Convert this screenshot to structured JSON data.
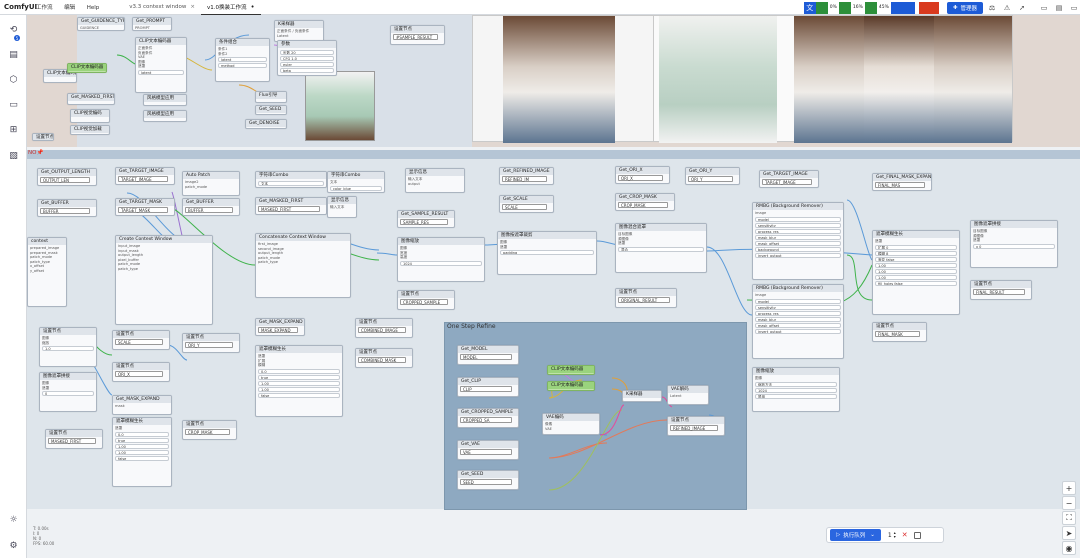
{
  "app": {
    "logo": "ComfyUI"
  },
  "menu": [
    "工作流",
    "编辑",
    "Help"
  ],
  "tabs": [
    {
      "label": "v3.3 context window",
      "close": "×"
    },
    {
      "label": "v1.0换装工作流",
      "modified": "•"
    }
  ],
  "topbar": {
    "stats": [
      {
        "label": "",
        "value": "0%",
        "color": "#2d8f3a"
      },
      {
        "label": "",
        "value": "16%",
        "color": "#2d8f3a"
      },
      {
        "label": "",
        "value": "45%",
        "color": "#2d8f3a"
      },
      {
        "label": "",
        "value": "",
        "color": "#1d5bd6"
      },
      {
        "label": "",
        "value": "",
        "color": "#d93a1e"
      }
    ],
    "manager_label": "管理器"
  },
  "sidebar": {
    "badge": "5",
    "icons": [
      "history-icon",
      "node-library-icon",
      "model-library-icon",
      "workflows-icon",
      "templates-icon",
      "images-icon",
      "settings-gear-icon",
      "theme-icon"
    ]
  },
  "groups": {
    "red_label": "NO📌",
    "sub_title": "One Step Refine"
  },
  "nodes": {
    "n1": {
      "title": "Get_GUIDENCE_TYPE",
      "rows": [
        "GUIDENCE"
      ]
    },
    "n2": {
      "title": "Get_PROMPT",
      "rows": [
        "PROMPT"
      ]
    },
    "n3": {
      "title": "Get_SAMPLE_RESULT",
      "rows": [
        "#SAMPLE_RESULT"
      ]
    },
    "n4": {
      "title": "Get_OUTPUT_LENGTH",
      "rows": [
        "OUTPUT_LEN"
      ]
    },
    "n5": {
      "title": "Get_BUFFER",
      "rows": [
        "BUFFER"
      ]
    },
    "n6": {
      "title": "Get_TARGET_IMAGE",
      "rows": [
        "TARGET_IMAGE"
      ]
    },
    "n7": {
      "title": "Get_TARGET_MASK",
      "rows": [
        "TARGET_MASK"
      ]
    },
    "n8": {
      "title": "Auto Patch",
      "rows": [
        "image2",
        "patch_mode"
      ]
    },
    "n9": {
      "title": "Get_BUFFER",
      "rows": [
        "BUFFER"
      ]
    },
    "n10": {
      "title": "Get_MASKED_FIRST",
      "rows": [
        "MASKED_FIRST"
      ]
    },
    "n11": {
      "title": "Create Context Window",
      "rows": [
        "input_image",
        "input_mask",
        "output_length",
        "pixel_buffer",
        "patch_mode",
        "patch_type"
      ]
    },
    "n12": {
      "title": "Concatenate Context Window",
      "rows": [
        "first_image",
        "second_image",
        "output_length",
        "patch_mode",
        "patch_type"
      ]
    },
    "n13": {
      "title": "Get_REFINED_IMAGE",
      "rows": [
        "REFINED_IM"
      ]
    },
    "n14": {
      "title": "Get_SCALE",
      "rows": [
        "SCALE"
      ]
    },
    "n15": {
      "title": "Get_SAMPLE_RESULT",
      "rows": [
        "SAMPLE_RES"
      ]
    },
    "n16": {
      "title": "图像缩放",
      "rows": [
        "图像",
        "宽度",
        "高度"
      ]
    },
    "n17": {
      "title": "Get_CROP_MASK",
      "rows": [
        "CROP_MASK"
      ]
    },
    "n18": {
      "title": "Get_ORI_X",
      "rows": [
        "ORI_X"
      ]
    },
    "n19": {
      "title": "Get_ORI_Y",
      "rows": [
        "ORI_Y"
      ]
    },
    "n20": {
      "title": "Get_TARGET_IMAGE",
      "rows": [
        "TARGET_IMAGE"
      ]
    },
    "n21": {
      "title": "Get_FINAL_MASK_EXPAND",
      "rows": [
        "FINAL_MAS"
      ]
    },
    "n22": {
      "title": "RMBG (Background Remover)",
      "rows": [
        "image",
        "model",
        "sensitivity",
        "process_res",
        "mask_blur",
        "mask_offset",
        "background",
        "invert_output"
      ]
    },
    "n23": {
      "title": "RMBG (Background Remover)",
      "rows": [
        "image",
        "model",
        "sensitivity",
        "process_res",
        "mask_blur",
        "mask_offset",
        "invert_output"
      ]
    },
    "n24": {
      "title": "图像混合遮罩",
      "rows": [
        "目标图像",
        "源图像",
        "遮罩"
      ]
    },
    "n25": {
      "title": "设置节点",
      "rows": [
        "ORIGINAL_RESULT"
      ]
    },
    "n26": {
      "title": "设置节点",
      "rows": [
        "CROPPED_SAMPLE"
      ]
    },
    "n27": {
      "title": "Get_MASK_EXPAND",
      "rows": [
        "MASK_EXPAND"
      ]
    },
    "n28": {
      "title": "遮罩模糊生长",
      "rows": [
        "遮罩",
        "扩展",
        "模糊"
      ]
    },
    "n29": {
      "title": "设置节点",
      "rows": [
        "COMBINED_IMAGE"
      ]
    },
    "n30": {
      "title": "设置节点",
      "rows": [
        "COMBINED_MASK"
      ]
    },
    "n31": {
      "title": "Get_MODEL",
      "rows": [
        "MODEL"
      ]
    },
    "n32": {
      "title": "Get_CLIP",
      "rows": [
        "CLIP"
      ]
    },
    "n33": {
      "title": "Get_CROPPED_SAMPLE",
      "rows": [
        "CROPPED_SA"
      ]
    },
    "n34": {
      "title": "Get_VAE",
      "rows": [
        "VAE"
      ]
    },
    "n35": {
      "title": "Get_SEED",
      "rows": [
        "SEED"
      ]
    },
    "n36": {
      "title": "CLIP文本编码器",
      "rows": []
    },
    "n37": {
      "title": "CLIP文本编码器",
      "rows": []
    },
    "n38": {
      "title": "VAE编码",
      "rows": [
        "像素",
        "VAE"
      ]
    },
    "n39": {
      "title": "K采样器",
      "rows": [
        "模型",
        "正面条件",
        "负面条件",
        "Latent"
      ]
    },
    "n40": {
      "title": "VAE解码",
      "rows": [
        "Latent",
        "VAE"
      ]
    },
    "n41": {
      "title": "设置节点",
      "rows": [
        "REFINED_IMAGE"
      ]
    },
    "n42": {
      "title": "图像遮罩拼接",
      "rows": [
        "目标图像",
        "源图像",
        "遮罩"
      ]
    },
    "n43": {
      "title": "设置节点",
      "rows": [
        "FINAL_RESULT"
      ]
    },
    "n44": {
      "title": "设置节点",
      "rows": [
        "FINAL_MASK"
      ]
    },
    "n45": {
      "title": "图像缩放",
      "rows": [
        "图像"
      ]
    },
    "n46": {
      "title": "设置节点",
      "rows": [
        "SCALE"
      ]
    },
    "n47": {
      "title": "遮罩模糊生长",
      "rows": [
        "遮罩"
      ]
    },
    "n48": {
      "title": "Get_MASK_EXPAND",
      "rows": [
        "MASK_EXPAND"
      ]
    },
    "n49": {
      "title": "设置节点",
      "rows": [
        "MASKED_FIRST"
      ]
    },
    "n50": {
      "title": "设置节点",
      "rows": [
        "CROP_MASK"
      ]
    },
    "n51": {
      "title": "Get_MASKED_FIRST",
      "rows": [
        "MASKED_FIRST"
      ]
    },
    "n52": {
      "title": "设置节点",
      "rows": [
        "ORI_Y"
      ]
    },
    "n53": {
      "title": "设置节点",
      "rows": [
        "ORI_X"
      ]
    },
    "n54": {
      "title": "遮罩预览",
      "rows": [
        "遮罩"
      ]
    },
    "n55": {
      "title": "设置节点",
      "rows": [
        "CROPPED_MASK"
      ]
    }
  },
  "queue": {
    "run_label": "执行队列",
    "count": "1"
  },
  "bottom_stats": [
    "T: 0.00s",
    "I: 0",
    "N: 0",
    "FPS: 60.00"
  ]
}
